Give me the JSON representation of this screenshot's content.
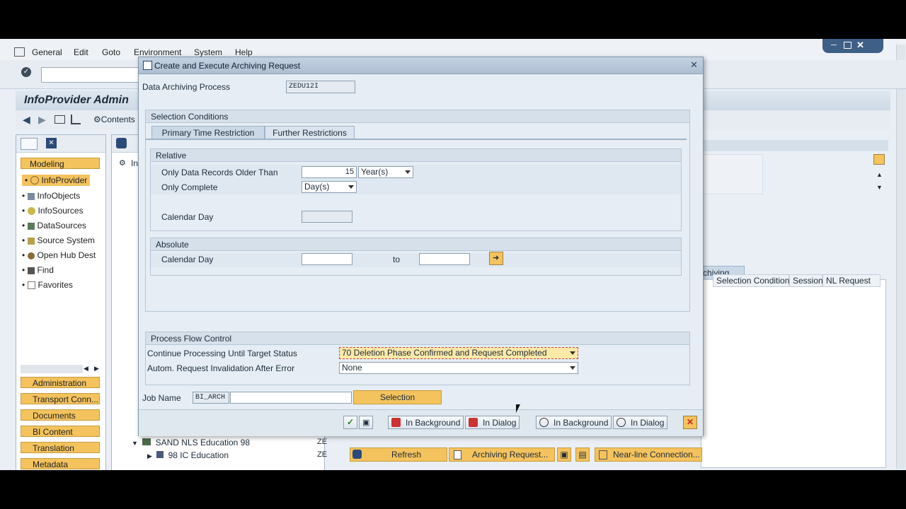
{
  "menu": [
    "General",
    "Edit",
    "Goto",
    "Environment",
    "System",
    "Help"
  ],
  "page_title": "InfoProvider Admin",
  "appbar": {
    "contents_label": "Contents"
  },
  "nav": {
    "modeling_label": "Modeling",
    "tree_items": [
      "InfoProvider",
      "InfoObjects",
      "InfoSources",
      "DataSources",
      "Source System",
      "Open Hub Dest",
      "Find",
      "Favorites"
    ],
    "bottom_buttons": [
      "Administration",
      "Transport Conn...",
      "Documents",
      "BI Content",
      "Translation",
      "Metadata Reposi..."
    ]
  },
  "center_tree": {
    "partial_label": "In",
    "node_sand": "SAND NLS Education 98",
    "node_98ic": "98 IC Education",
    "col_prefix": "ZE"
  },
  "right_panel": {
    "tab_archiving": "rchiving",
    "columns": [
      "Selection Condition",
      "Session",
      "NL Request"
    ],
    "buttons": {
      "refresh": "Refresh",
      "archiving_request": "Archiving Request...",
      "nearline": "Near-line Connection..."
    }
  },
  "dialog": {
    "title": "Create and Execute Archiving Request",
    "data_archiving_process_label": "Data Archiving Process",
    "data_archiving_process_value": "ZEDU12I",
    "selection_conditions_label": "Selection Conditions",
    "tabs": [
      "Primary Time Restriction",
      "Further Restrictions"
    ],
    "relative": {
      "group_label": "Relative",
      "older_than_label": "Only Data Records Older Than",
      "older_than_value": "15",
      "older_than_unit": "Year(s)",
      "only_complete_label": "Only Complete",
      "only_complete_value": "Day(s)",
      "calendar_day_label": "Calendar Day",
      "calendar_day_value": ""
    },
    "absolute": {
      "group_label": "Absolute",
      "calendar_day_label": "Calendar Day",
      "from_value": "",
      "to_label": "to",
      "to_value": ""
    },
    "process_flow": {
      "group_label": "Process Flow Control",
      "target_status_label": "Continue Processing Until Target Status",
      "target_status_value": "70 Deletion Phase Confirmed and Request Completed",
      "invalidation_label": "Autom. Request Invalidation After Error",
      "invalidation_value": "None"
    },
    "job_name_label": "Job Name",
    "job_name_prefix": "BI_ARCH",
    "job_name_value": "",
    "selection_button": "Selection",
    "footer_buttons": [
      "In Background",
      "In Dialog",
      "In Background",
      "In Dialog"
    ]
  },
  "colors": {
    "accent_yellow": "#f4c35e",
    "dialog_bg": "#e6edf4",
    "frame_blue": "#d6e0ea"
  }
}
